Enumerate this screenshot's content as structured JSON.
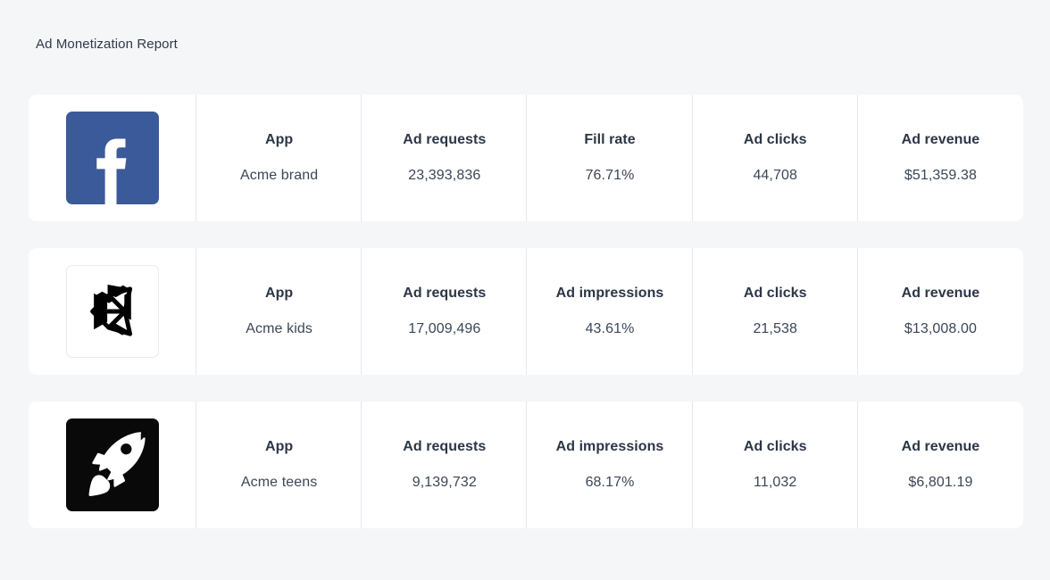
{
  "page": {
    "title": "Ad Monetization Report",
    "background_color": "#f5f6f7",
    "card_background_color": "#ffffff",
    "divider_color": "#e4e8ed",
    "label_color": "#2c3647",
    "value_color": "#3b4657"
  },
  "rows": [
    {
      "logo": {
        "icon": "facebook-icon",
        "name": "Facebook",
        "background_color": "#3b5a9a",
        "mark_color": "#ffffff"
      },
      "metrics": [
        {
          "label": "App",
          "value": "Acme brand"
        },
        {
          "label": "Ad requests",
          "value": "23,393,836"
        },
        {
          "label": "Fill rate",
          "value": "76.71%"
        },
        {
          "label": "Ad clicks",
          "value": "44,708"
        },
        {
          "label": "Ad revenue",
          "value": "$51,359.38"
        }
      ]
    },
    {
      "logo": {
        "icon": "unity-icon",
        "name": "Unity",
        "background_color": "#ffffff",
        "mark_color": "#000000"
      },
      "metrics": [
        {
          "label": "App",
          "value": "Acme kids"
        },
        {
          "label": "Ad requests",
          "value": "17,009,496"
        },
        {
          "label": "Ad impressions",
          "value": "43.61%"
        },
        {
          "label": "Ad clicks",
          "value": "21,538"
        },
        {
          "label": "Ad revenue",
          "value": "$13,008.00"
        }
      ]
    },
    {
      "logo": {
        "icon": "rocket-icon",
        "name": "Rocket",
        "background_color": "#090909",
        "mark_color": "#ffffff"
      },
      "metrics": [
        {
          "label": "App",
          "value": "Acme teens"
        },
        {
          "label": "Ad requests",
          "value": "9,139,732"
        },
        {
          "label": "Ad impressions",
          "value": "68.17%"
        },
        {
          "label": "Ad clicks",
          "value": "11,032"
        },
        {
          "label": "Ad revenue",
          "value": "$6,801.19"
        }
      ]
    }
  ]
}
